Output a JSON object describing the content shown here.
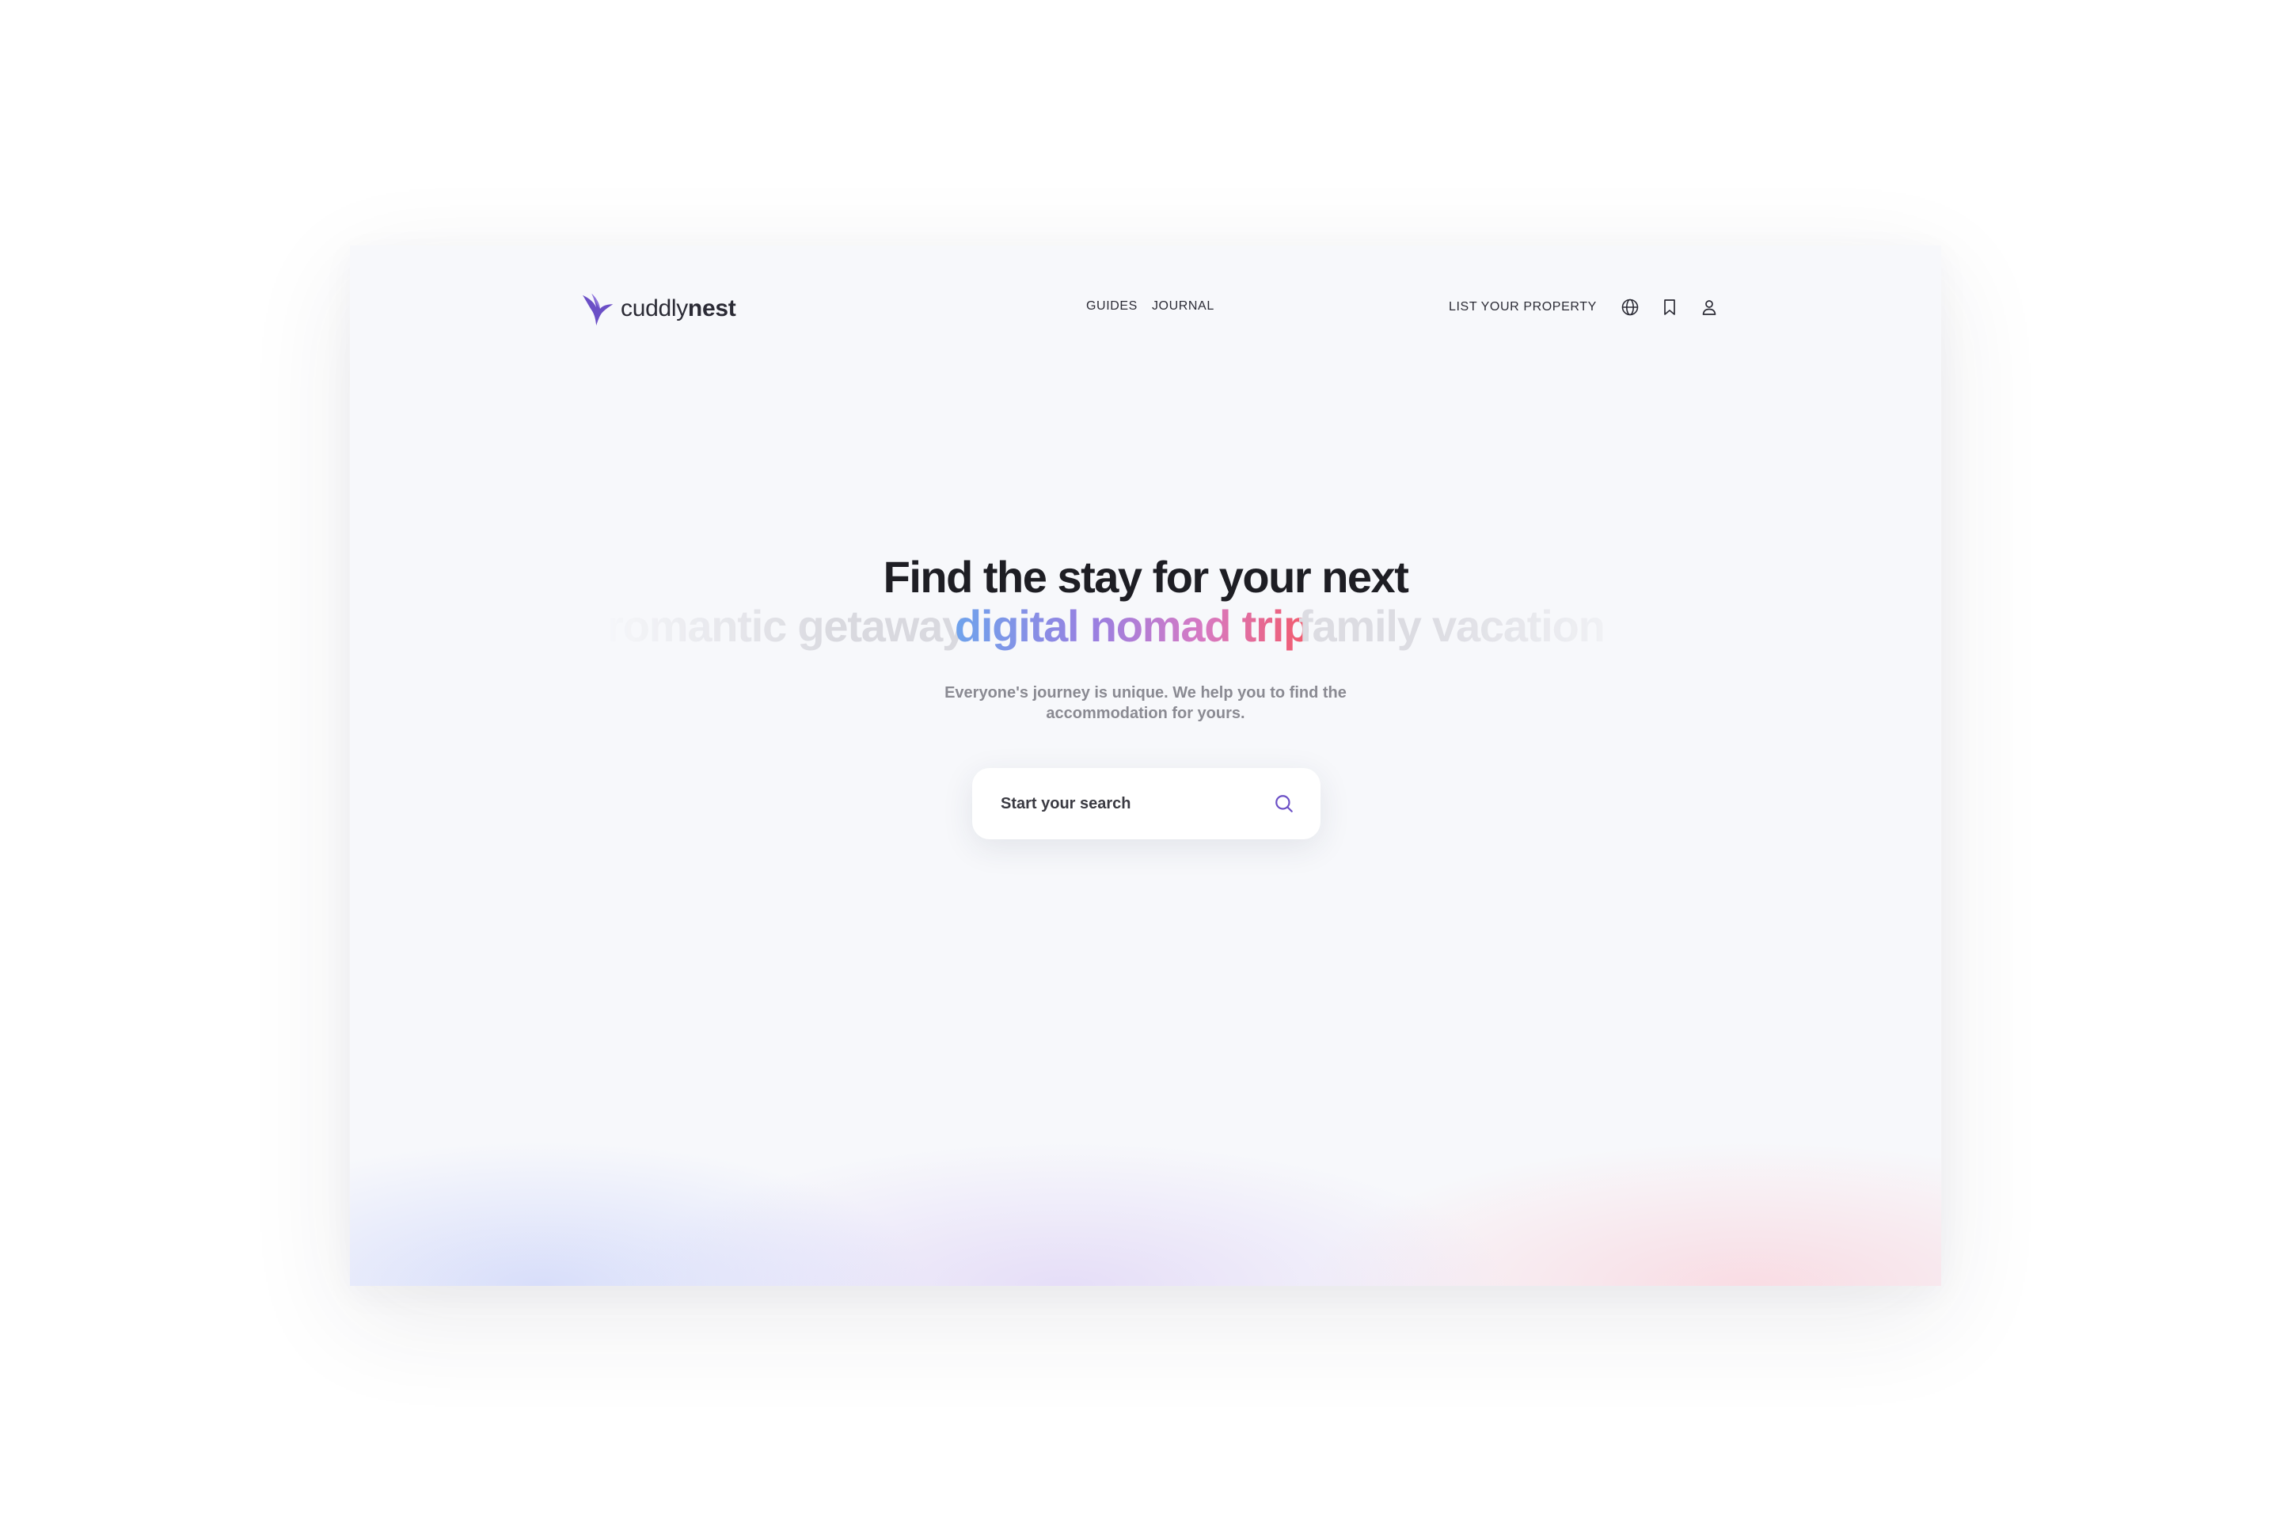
{
  "brand": {
    "name_light": "cuddly",
    "name_bold": "nest",
    "accent": "#6b4fc6"
  },
  "nav": {
    "links": [
      {
        "label": "GUIDES"
      },
      {
        "label": "JOURNAL"
      }
    ],
    "list_property": "LIST YOUR PROPERTY",
    "icons": [
      "globe-icon",
      "bookmark-icon",
      "user-icon"
    ]
  },
  "hero": {
    "title": "Find the stay for your next",
    "rotating_words": {
      "previous": "romantic getaway",
      "active": "digital nomad trip",
      "next": "family vacation"
    },
    "subtitle": "Everyone's journey is unique. We help you to find the accommodation for yours."
  },
  "search": {
    "placeholder": "Start your search",
    "icon": "search-icon"
  },
  "colors": {
    "gradient": [
      "#6fa3ec",
      "#9b7fe0",
      "#d77ac3",
      "#f25a6b"
    ],
    "text_dark": "#1e1e24",
    "text_muted": "#8a8a92",
    "background": "#f7f8fb"
  }
}
